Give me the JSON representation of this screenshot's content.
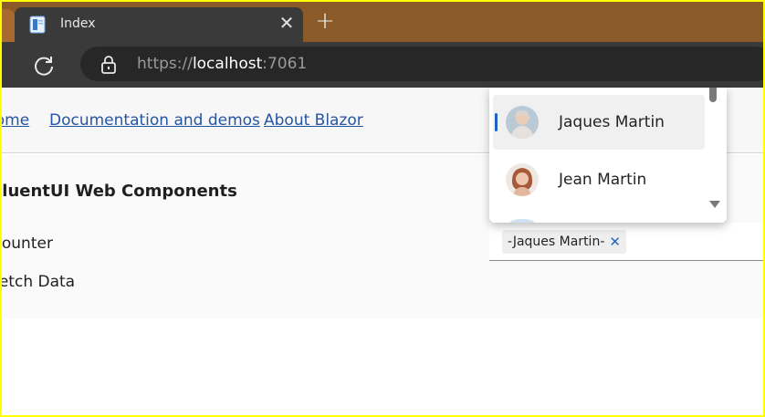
{
  "browser": {
    "tab_title": "Index",
    "url_scheme": "https://",
    "url_host": "localhost",
    "url_port": ":7061"
  },
  "nav": {
    "home": "Home",
    "documentation": "Documentation and demos",
    "about": "About Blazor"
  },
  "sidebar": {
    "heading": "FluentUI Web Components",
    "items": [
      "Counter",
      "Fetch Data"
    ]
  },
  "picker": {
    "selected_chip": "-Jaques Martin-",
    "options": [
      {
        "label": "Jaques Martin",
        "selected": true,
        "avatar": "avatar-icon"
      },
      {
        "label": "Jean Martin",
        "selected": false,
        "avatar": "avatar-icon"
      }
    ]
  },
  "colors": {
    "accent": "#1a63c4",
    "link": "#2456a4",
    "tabstrip": "#8a5a28"
  }
}
